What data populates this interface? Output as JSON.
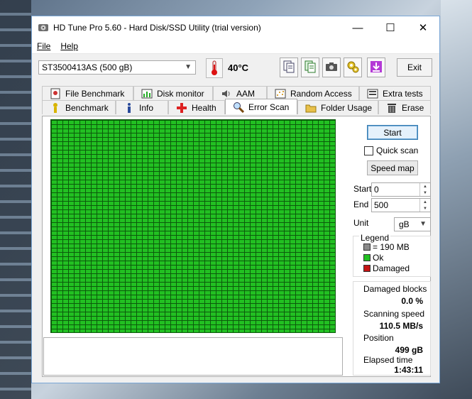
{
  "window": {
    "title": "HD Tune Pro 5.60 - Hard Disk/SSD Utility (trial version)"
  },
  "window_controls": {
    "minimize": "—",
    "maximize": "☐",
    "close": "✕"
  },
  "menu": {
    "file": "File",
    "help": "Help"
  },
  "toolbar": {
    "drive": "ST3500413AS (500 gB)",
    "temperature": "40°C",
    "exit_label": "Exit"
  },
  "tabs_row1": [
    {
      "label": "File Benchmark",
      "icon": "file-benchmark-icon"
    },
    {
      "label": "Disk monitor",
      "icon": "disk-monitor-icon"
    },
    {
      "label": "AAM",
      "icon": "speaker-icon"
    },
    {
      "label": "Random Access",
      "icon": "random-access-icon"
    },
    {
      "label": "Extra tests",
      "icon": "extra-tests-icon"
    }
  ],
  "tabs_row2": [
    {
      "label": "Benchmark",
      "icon": "benchmark-icon"
    },
    {
      "label": "Info",
      "icon": "info-icon"
    },
    {
      "label": "Health",
      "icon": "health-cross-icon"
    },
    {
      "label": "Error Scan",
      "icon": "magnifier-icon"
    },
    {
      "label": "Folder Usage",
      "icon": "folder-icon"
    },
    {
      "label": "Erase",
      "icon": "trash-icon"
    }
  ],
  "controls": {
    "start_button": "Start",
    "quick_scan": "Quick scan",
    "speed_map": "Speed map",
    "start_label": "Start",
    "start_value": "0",
    "end_label": "End",
    "end_value": "500",
    "unit_label": "Unit",
    "unit_value": "gB"
  },
  "legend": {
    "title": "Legend",
    "block_size": "= 190 MB",
    "ok": "Ok",
    "damaged": "Damaged"
  },
  "colors": {
    "ok": "#22c022",
    "damaged": "#c41414",
    "block": "#8a8a8a"
  },
  "stats": {
    "damaged_blocks_label": "Damaged blocks",
    "damaged_blocks_value": "0.0 %",
    "scanning_speed_label": "Scanning speed",
    "scanning_speed_value": "110.5 MB/s",
    "position_label": "Position",
    "position_value": "499 gB",
    "elapsed_label": "Elapsed time",
    "elapsed_value": "1:43:11"
  }
}
